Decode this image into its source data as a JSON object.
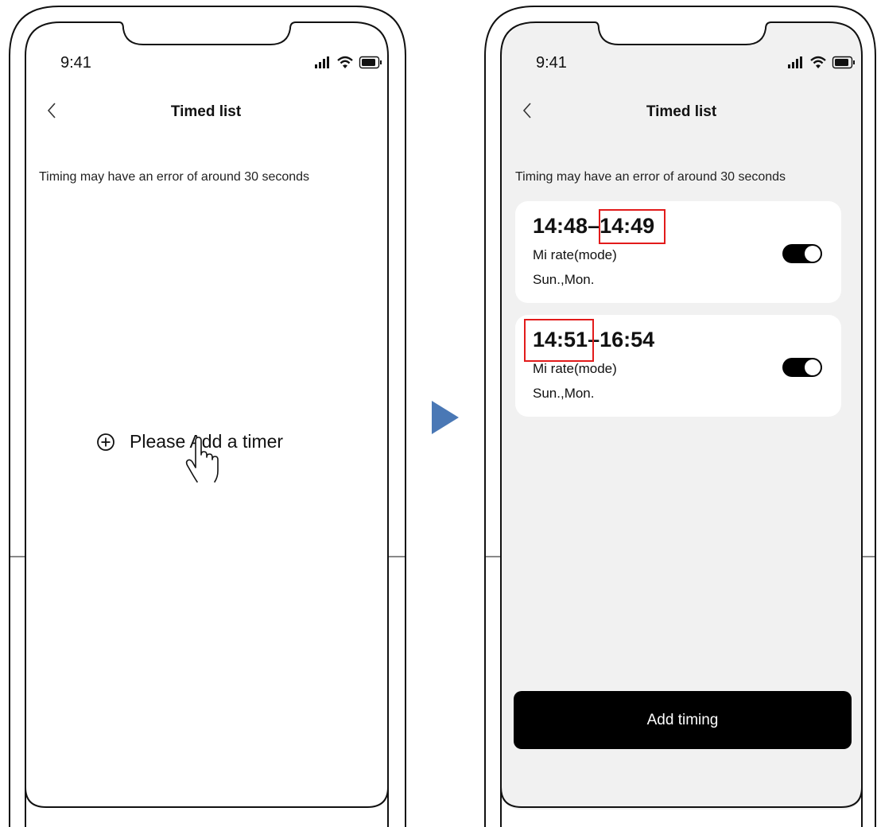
{
  "phone_left": {
    "status_time": "9:41",
    "title": "Timed list",
    "note": "Timing may have an error of around 30 seconds",
    "empty_label": "Please Add a timer",
    "icons": [
      "back-chevron-icon",
      "signal-icon",
      "wifi-icon",
      "battery-icon",
      "add-circle-icon",
      "pointer-hand-icon"
    ]
  },
  "transition": {
    "icon": "right-arrow-icon",
    "color": "#4a78b5"
  },
  "phone_right": {
    "status_time": "9:41",
    "title": "Timed list",
    "note": "Timing may have an error of around 30 seconds",
    "timers": [
      {
        "start": "14:48",
        "sep": "–",
        "end": "14:49",
        "mode": "Mi rate(mode)",
        "days": "Sun.,Mon.",
        "enabled": true,
        "highlight": "end"
      },
      {
        "start": "14:51",
        "sep": "–",
        "end": "16:54",
        "mode": "Mi rate(mode)",
        "days": "Sun.,Mon.",
        "enabled": true,
        "highlight": "start"
      }
    ],
    "add_button": "Add timing"
  },
  "colors": {
    "highlight": "#e21b1b",
    "screen_bg_right": "#f1f1f1",
    "button_bg": "#000000"
  }
}
